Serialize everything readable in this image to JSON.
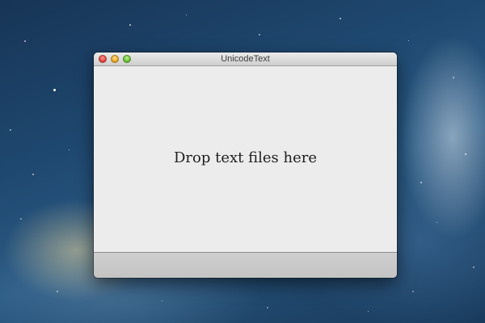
{
  "window": {
    "title": "UnicodeText",
    "controls": {
      "close": "close-icon",
      "minimize": "minimize-icon",
      "zoom": "zoom-icon"
    }
  },
  "content": {
    "drop_message": "Drop text files here"
  },
  "colors": {
    "desktop_background": "#1f4870",
    "window_background": "#ececec",
    "bottom_bar": "#c8c8c8",
    "close_button": "#e0443e",
    "minimize_button": "#e5a52b",
    "zoom_button": "#6cbf3a"
  }
}
